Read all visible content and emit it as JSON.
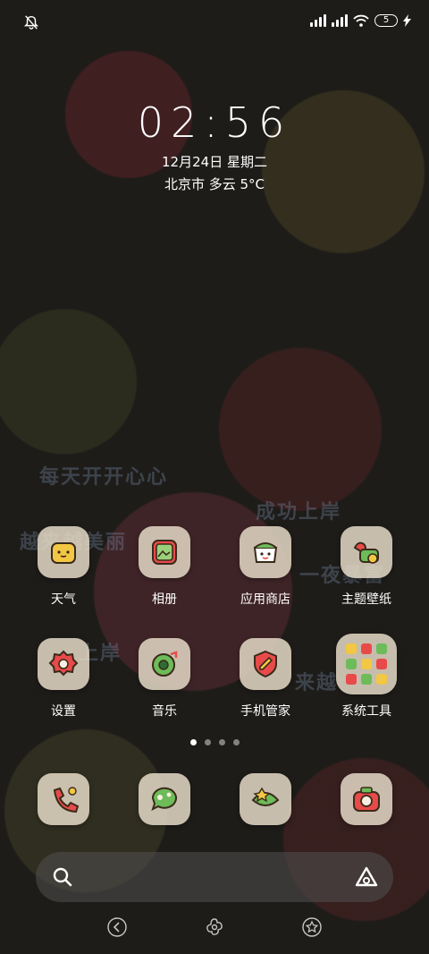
{
  "status_bar": {
    "battery_level": "5",
    "icons": [
      "mute-bell-icon",
      "signal-icon",
      "signal-icon",
      "wifi-icon",
      "battery-icon",
      "charging-icon"
    ]
  },
  "lock_clock": {
    "time": "02:56",
    "date": "12月24日 星期二",
    "weather": "北京市 多云 5°C"
  },
  "wallpaper_text": [
    "每天开开心心",
    "越来越美丽",
    "成功上岸",
    "一夜暴富",
    "上岸",
    "来越"
  ],
  "apps_row1": [
    {
      "label": "天气",
      "icon": "weather-icon"
    },
    {
      "label": "相册",
      "icon": "gallery-icon"
    },
    {
      "label": "应用商店",
      "icon": "app-store-icon"
    },
    {
      "label": "主题壁纸",
      "icon": "themes-icon"
    }
  ],
  "apps_row2": [
    {
      "label": "设置",
      "icon": "settings-icon"
    },
    {
      "label": "音乐",
      "icon": "music-icon"
    },
    {
      "label": "手机管家",
      "icon": "security-icon"
    },
    {
      "label": "系统工具",
      "icon": "folder-icon"
    }
  ],
  "dock": [
    {
      "icon": "phone-icon"
    },
    {
      "icon": "messages-icon"
    },
    {
      "icon": "browser-icon"
    },
    {
      "icon": "camera-icon"
    }
  ],
  "page_indicator": {
    "pages": 4,
    "current": 1
  },
  "colors": {
    "icon_bg": "#ebe1cd",
    "accent_red": "#e84a4a",
    "accent_green": "#6dbb59",
    "accent_yellow": "#f2c744"
  }
}
